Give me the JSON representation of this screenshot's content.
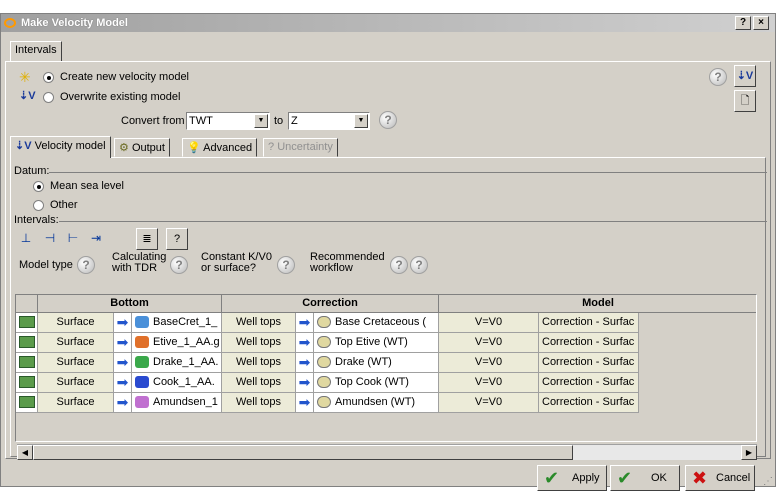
{
  "window": {
    "title": "Make Velocity Model",
    "help_button": "?",
    "close_button": "×"
  },
  "top_tab": "Intervals",
  "mode": {
    "create_label": "Create new velocity model",
    "overwrite_label": "Overwrite existing model",
    "selected": "create"
  },
  "convert": {
    "from_label": "Convert from",
    "from_value": "TWT",
    "to_label": "to",
    "to_value": "Z"
  },
  "tabs": [
    "Velocity model",
    "Output",
    "Advanced",
    "Uncertainty"
  ],
  "datum": {
    "label": "Datum:",
    "options": [
      "Mean sea level",
      "Other"
    ],
    "selected": "Mean sea level"
  },
  "intervals_label": "Intervals:",
  "column_hints": {
    "model_type": "Model type",
    "calc_tdr_line1": "Calculating",
    "calc_tdr_line2": "with TDR",
    "constant_line1": "Constant K/V0",
    "constant_line2": "or surface?",
    "recommended_line1": "Recommended",
    "recommended_line2": "workflow"
  },
  "table": {
    "headers": [
      "Bottom",
      "Correction",
      "Model"
    ],
    "rows": [
      {
        "type": "Surface",
        "surface": "BaseCret_1_",
        "corr_type": "Well tops",
        "corr": "Base Cretaceous (",
        "model": "V=V0",
        "workflow": "Correction - Surfac",
        "surf_color": "#4a90d9"
      },
      {
        "type": "Surface",
        "surface": "Etive_1_AA.g",
        "corr_type": "Well tops",
        "corr": "Top Etive (WT)",
        "model": "V=V0",
        "workflow": "Correction - Surfac",
        "surf_color": "#e0702a"
      },
      {
        "type": "Surface",
        "surface": "Drake_1_AA.",
        "corr_type": "Well tops",
        "corr": "Drake (WT)",
        "model": "V=V0",
        "workflow": "Correction - Surfac",
        "surf_color": "#3aa84a"
      },
      {
        "type": "Surface",
        "surface": "Cook_1_AA.",
        "corr_type": "Well tops",
        "corr": "Top Cook (WT)",
        "model": "V=V0",
        "workflow": "Correction - Surfac",
        "surf_color": "#2a4ad0"
      },
      {
        "type": "Surface",
        "surface": "Amundsen_1",
        "corr_type": "Well tops",
        "corr": "Amundsen (WT)",
        "model": "V=V0",
        "workflow": "Correction - Surfac",
        "surf_color": "#c070d0"
      }
    ]
  },
  "buttons": {
    "apply": "Apply",
    "ok": "OK",
    "cancel": "Cancel"
  }
}
